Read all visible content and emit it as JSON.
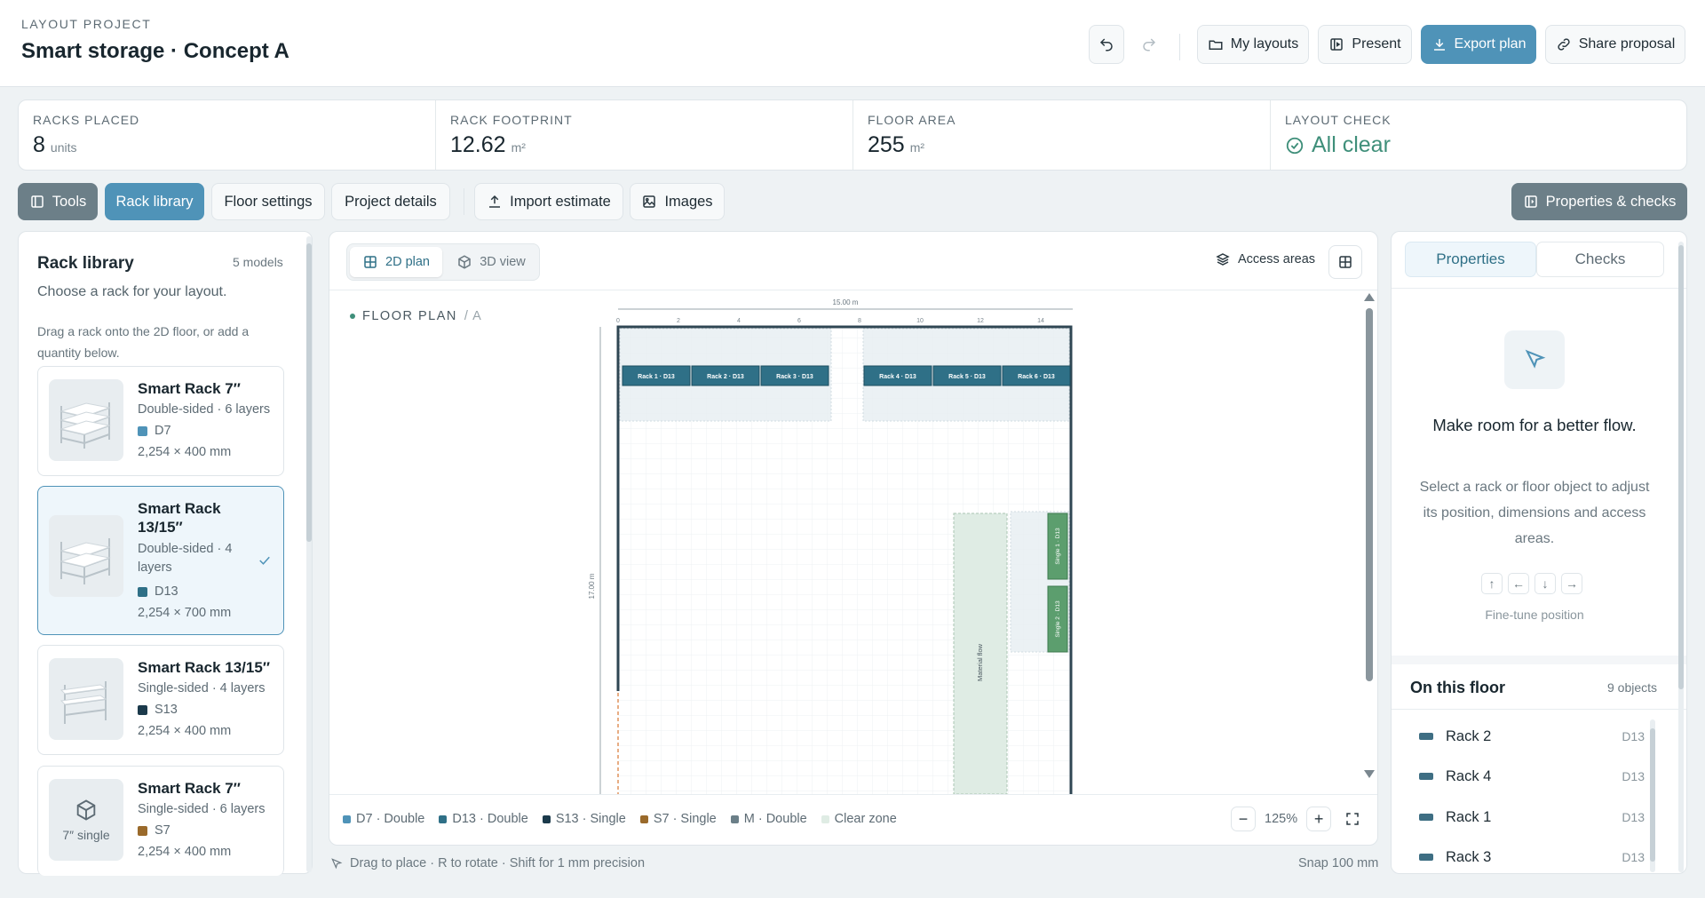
{
  "header": {
    "project_label": "LAYOUT PROJECT",
    "project_title": "Smart storage · Concept A",
    "buttons": {
      "my_layouts": "My layouts",
      "present": "Present",
      "export_plan": "Export plan",
      "share_proposal": "Share proposal"
    }
  },
  "stats": {
    "racks_placed": {
      "label": "RACKS PLACED",
      "value": "8",
      "unit": "units"
    },
    "rack_footprint": {
      "label": "RACK FOOTPRINT",
      "value": "12.62",
      "unit": "m²"
    },
    "floor_area": {
      "label": "FLOOR AREA",
      "value": "255",
      "unit": "m²"
    },
    "layout_check": {
      "label": "LAYOUT CHECK",
      "value": "All clear"
    }
  },
  "toolbar": {
    "tools": "Tools",
    "rack_library": "Rack library",
    "floor_settings": "Floor settings",
    "project_details": "Project details",
    "import_estimate": "Import estimate",
    "images": "Images",
    "properties_checks": "Properties & checks"
  },
  "library": {
    "title": "Rack library",
    "count": "5 models",
    "subtitle": "Choose a rack for your layout.",
    "hint": "Drag a rack onto the 2D floor, or add a quantity below.",
    "items": [
      {
        "name": "Smart Rack 7″",
        "desc": "Double-sided · 6 layers",
        "code": "D7",
        "color": "#4f93b8",
        "dims": "2,254 × 400 mm"
      },
      {
        "name": "Smart Rack 13/15″",
        "desc": "Double-sided · 4 layers",
        "code": "D13",
        "color": "#2f7087",
        "dims": "2,254 × 700 mm",
        "selected": true
      },
      {
        "name": "Smart Rack 13/15″",
        "desc": "Single-sided · 4 layers",
        "code": "S13",
        "color": "#1b3a4b",
        "dims": "2,254 × 400 mm"
      },
      {
        "name": "Smart Rack 7″",
        "desc": "Single-sided · 6 layers",
        "code": "S7",
        "color": "#9a6a2b",
        "dims": "2,254 × 400 mm",
        "thumb_label": "7″ single"
      }
    ]
  },
  "canvas": {
    "view_2d": "2D plan",
    "view_3d": "3D view",
    "access_areas": "Access areas",
    "floor_label": "FLOOR PLAN",
    "floor_suffix": "/ A",
    "width_label": "15.00 m",
    "height_label": "17.00 m",
    "ruler_ticks": [
      "0",
      "2",
      "4",
      "6",
      "8",
      "10",
      "12",
      "14"
    ],
    "racks_top": [
      "Rack 1 · D13",
      "Rack 2 · D13",
      "Rack 3 · D13",
      "Rack 4 · D13",
      "Rack 5 · D13",
      "Rack 6 · D13"
    ],
    "racks_side": [
      "Single 1 · D13",
      "Single 2 · D13"
    ],
    "material_flow": "Material flow",
    "legend": [
      {
        "label": "D7 · Double",
        "color": "#4f93b8"
      },
      {
        "label": "D13 · Double",
        "color": "#2f7087"
      },
      {
        "label": "S13 · Single",
        "color": "#1b3a4b"
      },
      {
        "label": "S7 · Single",
        "color": "#9a6a2b"
      },
      {
        "label": "M · Double",
        "color": "#6b7f88"
      },
      {
        "label": "Clear zone",
        "color": "#dfece4"
      }
    ],
    "zoom": "125%",
    "hint": "Drag to place · R to rotate · Shift for 1 mm precision",
    "snap": "Snap 100 mm"
  },
  "properties": {
    "tab_properties": "Properties",
    "tab_checks": "Checks",
    "empty_title": "Make room for a better flow.",
    "empty_text": "Select a rack or floor object to adjust its position, dimensions and access areas.",
    "fine_tune": "Fine-tune position",
    "arrows": [
      "↑",
      "←",
      "↓",
      "→"
    ],
    "on_floor_title": "On this floor",
    "on_floor_count": "9 objects",
    "floor_items": [
      {
        "name": "Rack 2",
        "code": "D13"
      },
      {
        "name": "Rack 4",
        "code": "D13"
      },
      {
        "name": "Rack 1",
        "code": "D13"
      },
      {
        "name": "Rack 3",
        "code": "D13"
      }
    ]
  }
}
